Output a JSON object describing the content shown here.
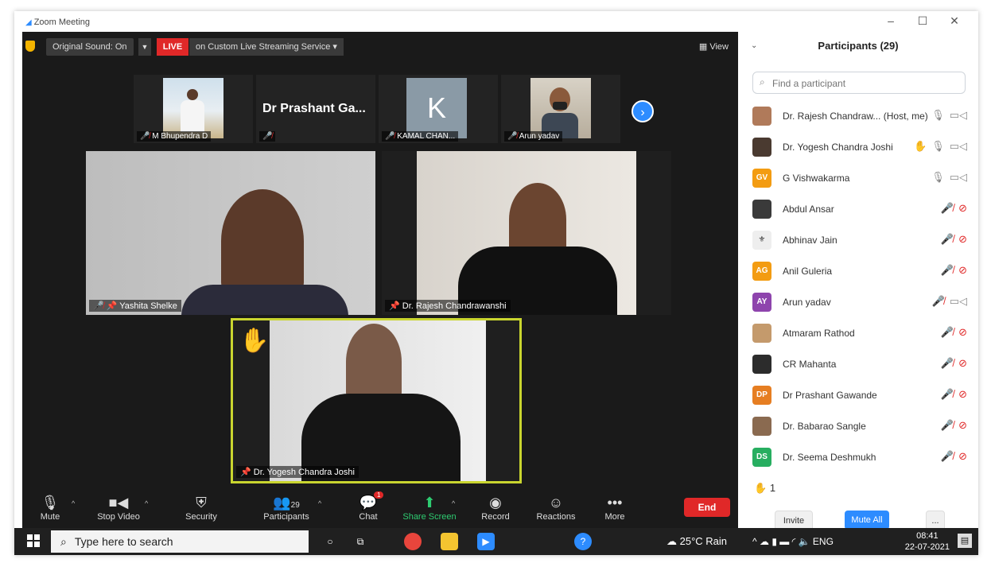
{
  "window": {
    "title": "Zoom Meeting",
    "controls": [
      "–",
      "☐",
      "✕"
    ]
  },
  "topbar": {
    "original_sound": "Original Sound: On",
    "live_badge": "LIVE",
    "stream_label": "on Custom Live Streaming Service",
    "view_label": "View"
  },
  "thumbnails": [
    {
      "name": "M Bhupendra D"
    },
    {
      "name": "Dr Prashant Ga..."
    },
    {
      "name": "KAMAL CHAN...",
      "initial": "K"
    },
    {
      "name": "Arun yadav"
    }
  ],
  "tiles": {
    "yashita": "Yashita Shelke",
    "rajesh": "Dr. Rajesh Chandrawanshi",
    "yogesh": "Dr. Yogesh Chandra Joshi"
  },
  "controls": {
    "mute": "Mute",
    "stop_video": "Stop Video",
    "security": "Security",
    "participants": "Participants",
    "participants_count": "29",
    "chat": "Chat",
    "chat_badge": "1",
    "share_screen": "Share Screen",
    "record": "Record",
    "reactions": "Reactions",
    "more": "More",
    "end": "End"
  },
  "panel": {
    "title": "Participants (29)",
    "search_placeholder": "Find a participant",
    "participants": [
      {
        "name": "Dr. Rajesh Chandraw...",
        "role": "(Host, me)",
        "avatar": "photo",
        "mic": "on",
        "video": "on"
      },
      {
        "name": "Dr. Yogesh Chandra Joshi",
        "avatar": "photo",
        "hand": true,
        "mic": "on",
        "video": "on"
      },
      {
        "name": "G Vishwakarma",
        "avatar_text": "GV",
        "avatar_color": "#f39c12",
        "mic": "on",
        "video": "on"
      },
      {
        "name": "Abdul Ansar",
        "avatar": "photo",
        "mic": "off",
        "video": "off"
      },
      {
        "name": "Abhinav Jain",
        "avatar": "photo",
        "mic": "off",
        "video": "off"
      },
      {
        "name": "Anil Guleria",
        "avatar_text": "AG",
        "avatar_color": "#f39c12",
        "mic": "off",
        "video": "off"
      },
      {
        "name": "Arun yadav",
        "avatar_text": "AY",
        "avatar_color": "#8e44ad",
        "mic": "off",
        "video": "on"
      },
      {
        "name": "Atmaram Rathod",
        "avatar": "photo",
        "mic": "off",
        "video": "off"
      },
      {
        "name": "CR Mahanta",
        "avatar": "photo",
        "mic": "off",
        "video": "off"
      },
      {
        "name": "Dr Prashant Gawande",
        "avatar_text": "DP",
        "avatar_color": "#e67e22",
        "mic": "off",
        "video": "off"
      },
      {
        "name": "Dr. Babarao Sangle",
        "avatar": "photo",
        "mic": "off",
        "video": "off"
      },
      {
        "name": "Dr. Seema Deshmukh",
        "avatar_text": "DS",
        "avatar_color": "#27ae60",
        "mic": "off",
        "video": "off"
      }
    ],
    "raised_hands": "1",
    "invite": "Invite",
    "mute_all": "Mute All",
    "more": "..."
  },
  "taskbar": {
    "search_placeholder": "Type here to search",
    "weather": "25°C  Rain",
    "language": "ENG",
    "time": "08:41",
    "date": "22-07-2021"
  }
}
